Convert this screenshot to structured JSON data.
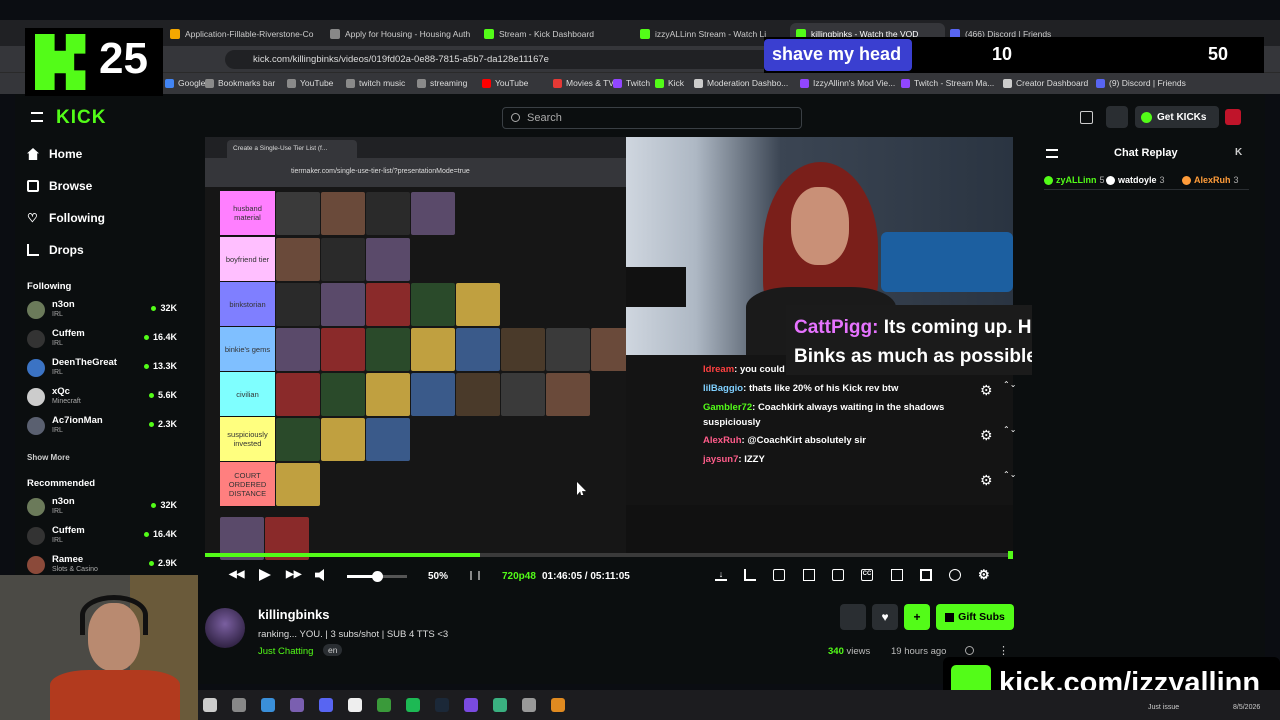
{
  "browser": {
    "tabs": [
      {
        "label": "Application-Fillable-Riverstone-Co",
        "color": "#f4a700"
      },
      {
        "label": "Apply for Housing - Housing Auth",
        "color": "#888888"
      },
      {
        "label": "Stream - Kick Dashboard",
        "color": "#53fc18"
      },
      {
        "label": "izzyALLinn Stream - Watch Li",
        "color": "#53fc18"
      },
      {
        "label": "killingbinks - Watch the VOD",
        "color": "#53fc18"
      },
      {
        "label": "(466) Discord | Friends",
        "color": "#5865f2"
      }
    ],
    "url": "kick.com/killingbinks/videos/019fd02a-0e88-7815-a5b7-da128e11167e",
    "bookmarks": [
      {
        "label": "Google",
        "color": "#4285f4"
      },
      {
        "label": "Bookmarks bar",
        "color": "#8a8a8a"
      },
      {
        "label": "YouTube",
        "color": "#8a8a8a"
      },
      {
        "label": "twitch music",
        "color": "#8a8a8a"
      },
      {
        "label": "streaming",
        "color": "#8a8a8a"
      },
      {
        "label": "YouTube",
        "color": "#ff0000"
      },
      {
        "label": "Movies & TV",
        "color": "#e53935"
      },
      {
        "label": "Twitch",
        "color": "#9146ff"
      },
      {
        "label": "Kick",
        "color": "#53fc18"
      },
      {
        "label": "Moderation Dashbo...",
        "color": "#cccccc"
      },
      {
        "label": "IzzyAllinn's Mod Vie...",
        "color": "#9146ff"
      },
      {
        "label": "Twitch - Stream Ma...",
        "color": "#9146ff"
      },
      {
        "label": "Creator Dashboard",
        "color": "#cccccc"
      },
      {
        "label": "(9) Discord | Friends",
        "color": "#5865f2"
      }
    ]
  },
  "overlay": {
    "logo_number": "25",
    "goal_label": "shave my head",
    "goal_current": "10",
    "goal_target": "50",
    "kick_url": "kick.com/izzyallinn"
  },
  "kick": {
    "logo": "KICK",
    "search_placeholder": "Search",
    "get_kicks": "Get KICKs",
    "nav": [
      "Home",
      "Browse",
      "Following",
      "Drops"
    ],
    "following_title": "Following",
    "following": [
      {
        "name": "n3on",
        "category": "IRL",
        "viewers": "32K",
        "color": "#6b7a5a"
      },
      {
        "name": "Cuffem",
        "category": "IRL",
        "viewers": "16.4K",
        "color": "#333333"
      },
      {
        "name": "DeenTheGreat",
        "category": "IRL",
        "viewers": "13.3K",
        "color": "#3b73c4"
      },
      {
        "name": "xQc",
        "category": "Minecraft",
        "viewers": "5.6K",
        "color": "#cccccc"
      },
      {
        "name": "Ac7ionMan",
        "category": "IRL",
        "viewers": "2.3K",
        "color": "#5a6070"
      }
    ],
    "show_more": "Show More",
    "recommended_title": "Recommended",
    "recommended": [
      {
        "name": "n3on",
        "category": "IRL",
        "viewers": "32K",
        "color": "#6b7a5a"
      },
      {
        "name": "Cuffem",
        "category": "IRL",
        "viewers": "16.4K",
        "color": "#333333"
      },
      {
        "name": "Ramee",
        "category": "Slots & Casino",
        "viewers": "2.9K",
        "color": "#8b4a3a"
      }
    ]
  },
  "video": {
    "inner_tab": "Create a Single-Use Tier List (f...",
    "inner_url": "tiermaker.com/single-use-tier-list/?presentationMode=true",
    "tiers": [
      {
        "label": "husband material",
        "color": "#ff7fff"
      },
      {
        "label": "boyfriend tier",
        "color": "#ffbfff"
      },
      {
        "label": "binkstorian",
        "color": "#7f7fff"
      },
      {
        "label": "binkie's gems",
        "color": "#7fbfff"
      },
      {
        "label": "civilian",
        "color": "#7fffff"
      },
      {
        "label": "suspiciously invested",
        "color": "#ffff7f"
      },
      {
        "label": "COURT ORDERED DISTANCE",
        "color": "#ff7f7f"
      }
    ],
    "tier_counts": [
      4,
      3,
      5,
      9,
      7,
      3,
      1
    ],
    "chat_messages": [
      {
        "user": "Idream",
        "text": "you could put me at the top binks",
        "user_color": "#ff4040"
      },
      {
        "user": "lilBaggio",
        "text": "thats like 20% of his Kick rev btw",
        "user_color": "#7fd0ff"
      },
      {
        "user": "Gambler72",
        "text": "Coachkirk always waiting in the shadows",
        "user_color": "#53fc18"
      },
      {
        "user": "",
        "text": "suspiciously",
        "user_color": "#ffffff"
      },
      {
        "user": "AlexRuh",
        "text": "@CoachKirt absolutely sir",
        "user_color": "#ff5c8a"
      },
      {
        "user": "jaysun7",
        "text": "IZZY",
        "user_color": "#ff5c8a"
      }
    ],
    "callout_user": "CattPigg:",
    "callout_text": "Its coming up. He needs to watch Binks as much as possible",
    "progress": 0.34,
    "volume": 0.5,
    "volume_label": "50%",
    "quality": "720p48",
    "time": "01:46:05 / 05:11:05"
  },
  "channel": {
    "name": "killingbinks",
    "title": "ranking... YOU. | 3 subs/shot | SUB 4 TTS <3",
    "category": "Just Chatting",
    "language": "en",
    "views": "340",
    "views_label": "views",
    "age": "19 hours ago",
    "gift_subs": "Gift Subs"
  },
  "chat": {
    "title": "Chat Replay",
    "top_gifters": [
      {
        "name": "zyALLinn",
        "count": "5",
        "color": "#53fc18"
      },
      {
        "name": "watdoyle",
        "count": "3",
        "color": "#ffffff"
      },
      {
        "name": "AlexRuh",
        "count": "3",
        "color": "#ff9c3a"
      }
    ]
  },
  "taskbar": {
    "status": "Just issue",
    "date": "8/5/2026"
  }
}
